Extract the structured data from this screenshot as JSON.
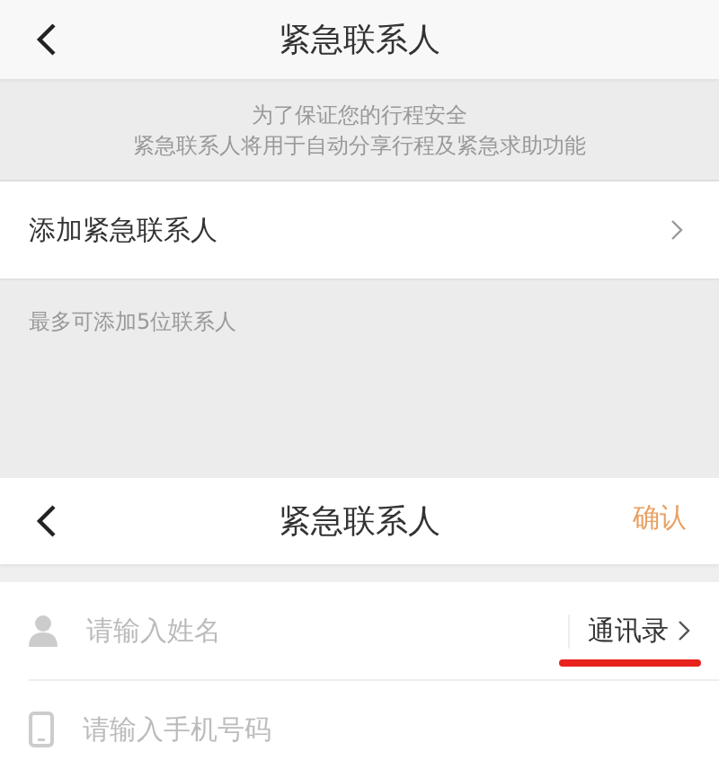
{
  "screens": [
    {
      "header": {
        "title": "紧急联系人"
      },
      "notice": [
        "为了保证您的行程安全",
        "紧急联系人将用于自动分享行程及紧急求助功能"
      ],
      "list_item": {
        "label": "添加紧急联系人"
      },
      "footnote": "最多可添加5位联系人"
    },
    {
      "header": {
        "title": "紧急联系人",
        "action": "确认"
      },
      "fields": [
        {
          "kind": "name",
          "placeholder": "请输入姓名",
          "link": "通讯录",
          "underlined": true
        },
        {
          "kind": "phone",
          "placeholder": "请输入手机号码"
        }
      ]
    }
  ]
}
